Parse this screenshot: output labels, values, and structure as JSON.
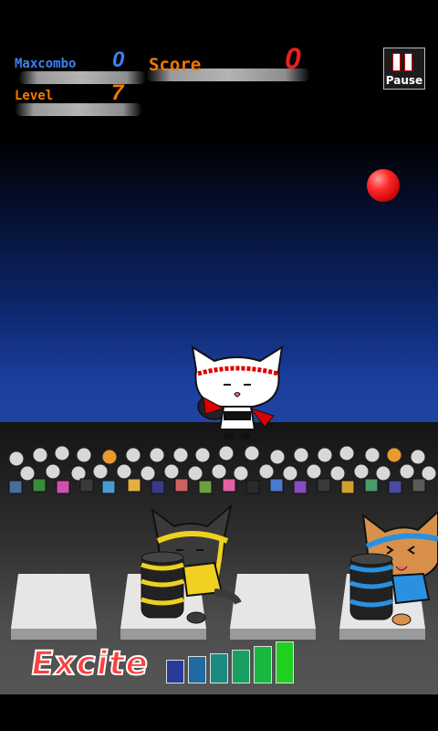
{
  "hud": {
    "maxcombo_label": "Maxcombo",
    "maxcombo_value": "0",
    "score_label": "Score",
    "score_value": "0",
    "level_label": "Level",
    "level_value": "7"
  },
  "pause_button": {
    "label": "Pause",
    "icon": "pause-icon"
  },
  "excite": {
    "label": "Excite",
    "meter_levels": 6,
    "meter_colors": [
      "#2a3a9a",
      "#1f6aa0",
      "#1d8a80",
      "#19a060",
      "#16b840",
      "#20d020"
    ]
  },
  "colors": {
    "label_blue": "#3b82f0",
    "label_orange": "#f07a00",
    "score_red": "#e82020",
    "ball_red": "#ff2a2a"
  }
}
